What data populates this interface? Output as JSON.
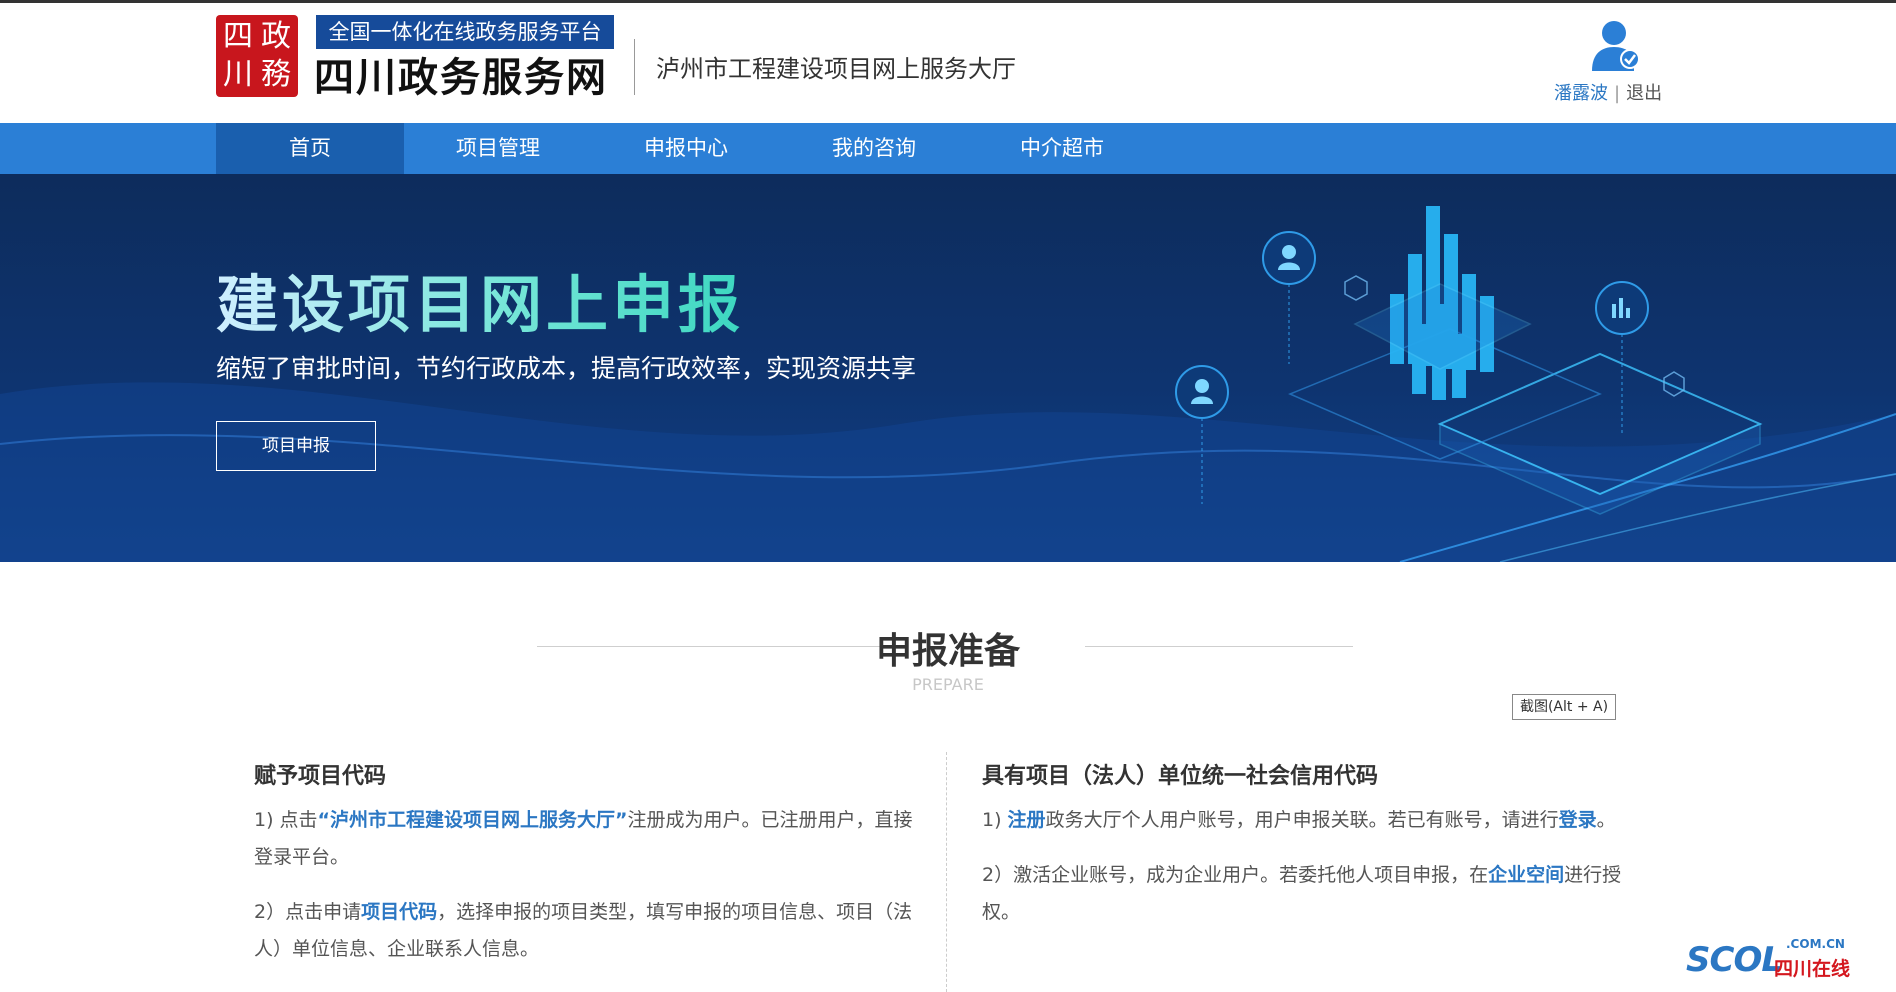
{
  "header": {
    "seal_chars": [
      "四",
      "川",
      "政",
      "務"
    ],
    "badge": "全国一体化在线政务服务平台",
    "brand": "四川政务服务网",
    "hall": "泸州市工程建设项目网上服务大厅",
    "user_name": "潘露波",
    "separator": "|",
    "logout": "退出",
    "avatar_icon": "user-verified-icon"
  },
  "nav": {
    "items": [
      "首页",
      "项目管理",
      "申报中心",
      "我的咨询",
      "中介超市"
    ],
    "active_index": 0
  },
  "banner": {
    "title": "建设项目网上申报",
    "subtitle": "缩短了审批时间，节约行政成本，提高行政效率，实现资源共享",
    "button": "项目申报"
  },
  "section": {
    "title": "申报准备",
    "subtitle": "PREPARE",
    "screenshot_hint": "截图(Alt + A)"
  },
  "left_col": {
    "heading": "赋予项目代码",
    "p1_pre": "1) 点击",
    "p1_link": "“泸州市工程建设项目网上服务大厅”",
    "p1_post": "注册成为用户。已注册用户，直接登录平台。",
    "p2_pre": "2）点击申请",
    "p2_link": "项目代码",
    "p2_post": "，选择申报的项目类型，填写申报的项目信息、项目（法人）单位信息、企业联系人信息。"
  },
  "right_col": {
    "heading": "具有项目（法人）单位统一社会信用代码",
    "p1_pre": "1) ",
    "p1_link1": "注册",
    "p1_mid": "政务大厅个人用户账号，用户申报关联。若已有账号，请进行",
    "p1_link2": "登录",
    "p1_post": "。",
    "p2_pre": "2）激活企业账号，成为企业用户。若委托他人项目申报，在",
    "p2_link": "企业空间",
    "p2_post": "进行授权。"
  },
  "watermark": {
    "logo": "SCOL",
    "domain": ".COM.CN",
    "cn": "四川在线"
  },
  "colors": {
    "nav": "#2b7fd6",
    "nav_active": "#1a5fae",
    "banner": "#0e3470",
    "accent": "#2b77c3",
    "seal": "#c8161d"
  }
}
